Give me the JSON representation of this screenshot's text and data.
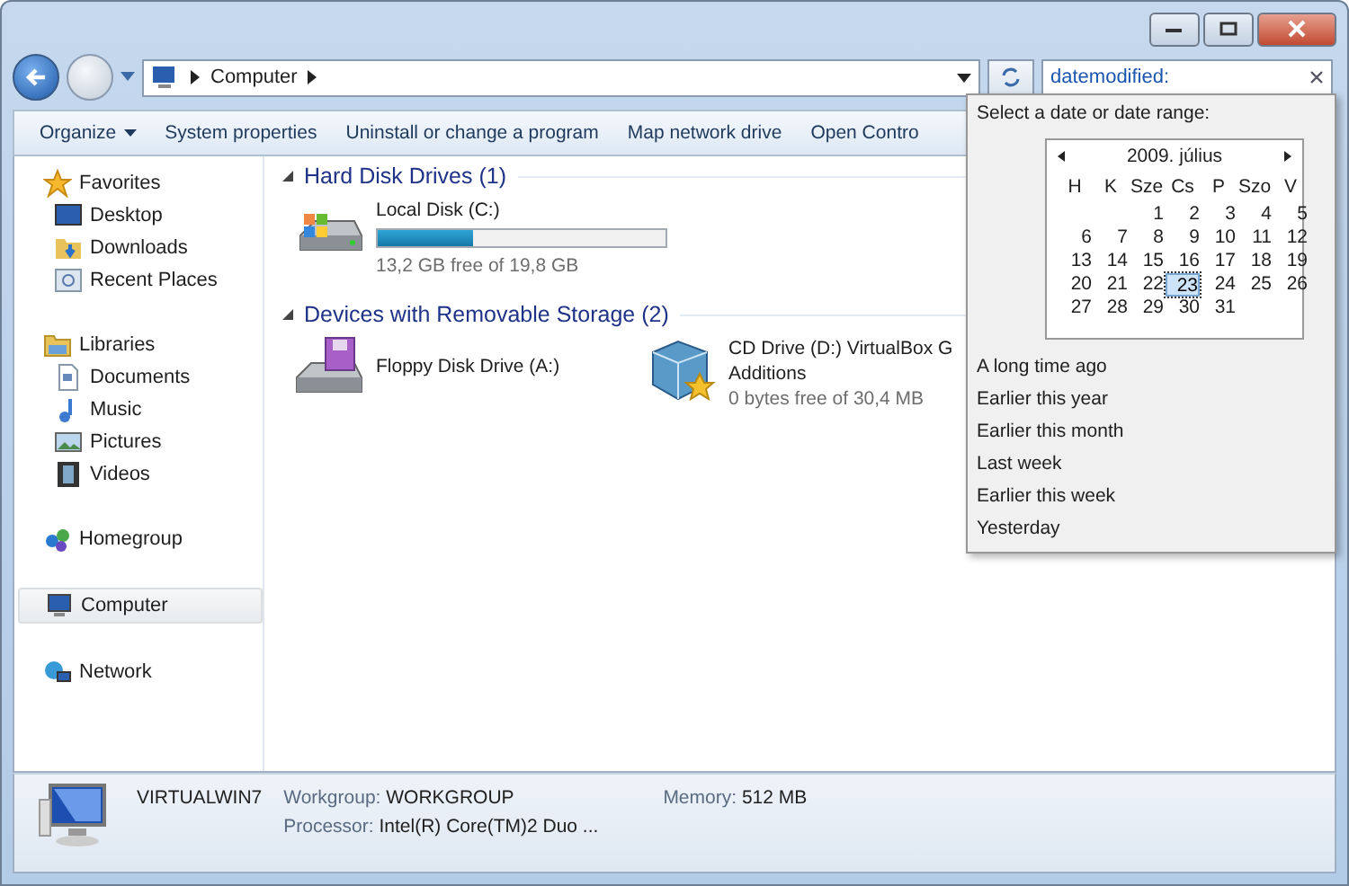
{
  "address_bar": {
    "crumbs": [
      "Computer"
    ]
  },
  "search": {
    "value": "datemodified:"
  },
  "toolbar": {
    "buttons": [
      {
        "label": "Organize",
        "kind": "menu"
      },
      {
        "label": "System properties",
        "kind": "plain"
      },
      {
        "label": "Uninstall or change a program",
        "kind": "plain"
      },
      {
        "label": "Map network drive",
        "kind": "plain"
      },
      {
        "label": "Open Contro",
        "kind": "plain"
      }
    ]
  },
  "sidebar": {
    "groups": [
      {
        "label": "Favorites",
        "selected": false,
        "children": [
          {
            "label": "Desktop"
          },
          {
            "label": "Downloads"
          },
          {
            "label": "Recent Places"
          }
        ]
      },
      {
        "label": "Libraries",
        "selected": false,
        "children": [
          {
            "label": "Documents"
          },
          {
            "label": "Music"
          },
          {
            "label": "Pictures"
          },
          {
            "label": "Videos"
          }
        ]
      },
      {
        "label": "Homegroup",
        "selected": false
      },
      {
        "label": "Computer",
        "selected": true
      },
      {
        "label": "Network",
        "selected": false
      }
    ]
  },
  "sections": [
    {
      "title": "Hard Disk Drives (1)",
      "items": [
        {
          "kind": "hdd",
          "name": "Local Disk (C:)",
          "level": 0.33,
          "info": "13,2 GB free of 19,8 GB"
        }
      ]
    },
    {
      "title": "Devices with Removable Storage (2)",
      "items": [
        {
          "kind": "floppy",
          "name": "Floppy Disk Drive (A:)"
        },
        {
          "kind": "cd",
          "name": "CD Drive (D:) VirtualBox G",
          "name_continued": "Additions",
          "info": "0 bytes free of 30,4 MB"
        }
      ]
    }
  ],
  "date_popup": {
    "prompt": "Select a date or date range:",
    "month": "2009. július",
    "weekdays": [
      "H",
      "K",
      "Sze",
      "Cs",
      "P",
      "Szo",
      "V"
    ],
    "weeks": [
      [
        {
          "day": "1",
          "selected": false
        },
        {
          "day": "2",
          "selected": false
        },
        {
          "day": "3",
          "selected": false
        },
        {
          "day": "4",
          "selected": false
        },
        {
          "day": "5",
          "selected": false
        }
      ],
      [
        {
          "day": "6",
          "selected": false
        },
        {
          "day": "7",
          "selected": false
        },
        {
          "day": "8",
          "selected": false
        },
        {
          "day": "9",
          "selected": false
        },
        {
          "day": "10",
          "selected": false
        },
        {
          "day": "11",
          "selected": false
        },
        {
          "day": "12",
          "selected": false
        }
      ],
      [
        {
          "day": "13",
          "selected": false
        },
        {
          "day": "14",
          "selected": false
        },
        {
          "day": "15",
          "selected": false
        },
        {
          "day": "16",
          "selected": false
        },
        {
          "day": "17",
          "selected": false
        },
        {
          "day": "18",
          "selected": false
        },
        {
          "day": "19",
          "selected": false
        }
      ],
      [
        {
          "day": "20",
          "selected": false
        },
        {
          "day": "21",
          "selected": false
        },
        {
          "day": "22",
          "selected": false
        },
        {
          "day": "23",
          "selected": true
        },
        {
          "day": "24",
          "selected": false
        },
        {
          "day": "25",
          "selected": false
        },
        {
          "day": "26",
          "selected": false
        }
      ],
      [
        {
          "day": "27",
          "selected": false
        },
        {
          "day": "28",
          "selected": false
        },
        {
          "day": "29",
          "selected": false
        },
        {
          "day": "30",
          "selected": false
        },
        {
          "day": "31",
          "selected": false
        }
      ]
    ],
    "ranges": [
      "A long time ago",
      "Earlier this year",
      "Earlier this month",
      "Last week",
      "Earlier this week",
      "Yesterday"
    ]
  },
  "details": {
    "name": "VIRTUALWIN7",
    "fields": [
      {
        "label": "Workgroup:",
        "value": "WORKGROUP"
      },
      {
        "label": "Memory:",
        "value": "512 MB"
      },
      {
        "label": "Processor:",
        "value": "Intel(R) Core(TM)2 Duo ..."
      }
    ]
  }
}
